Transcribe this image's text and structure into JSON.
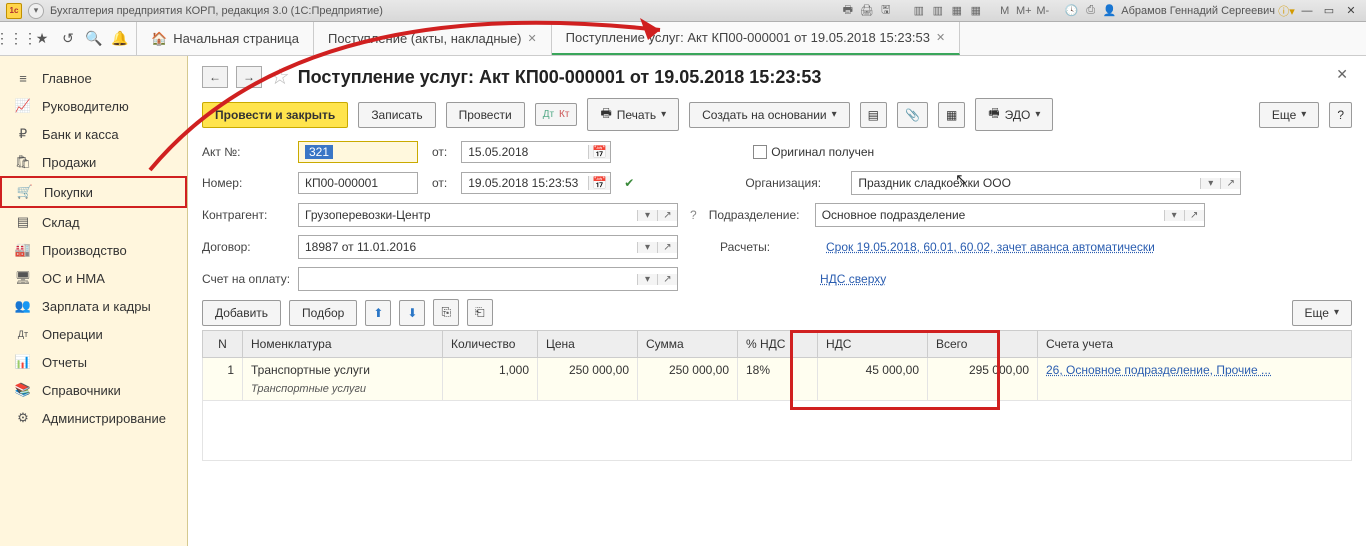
{
  "titlebar": {
    "title": "Бухгалтерия предприятия КОРП, редакция 3.0  (1С:Предприятие)",
    "user": "Абрамов Геннадий Сергеевич",
    "m_labels": [
      "M",
      "M+",
      "M-"
    ]
  },
  "tabs": {
    "home": "Начальная страница",
    "tab1": "Поступление (акты, накладные)",
    "tab2": "Поступление услуг: Акт КП00-000001 от 19.05.2018 15:23:53"
  },
  "sidebar": {
    "items": [
      {
        "label": "Главное",
        "icon": "≡"
      },
      {
        "label": "Руководителю",
        "icon": "📈"
      },
      {
        "label": "Банк и касса",
        "icon": "₽"
      },
      {
        "label": "Продажи",
        "icon": "🛍"
      },
      {
        "label": "Покупки",
        "icon": "🛒",
        "highlight": true
      },
      {
        "label": "Склад",
        "icon": "▤"
      },
      {
        "label": "Производство",
        "icon": "🏭"
      },
      {
        "label": "ОС и НМА",
        "icon": "🖥"
      },
      {
        "label": "Зарплата и кадры",
        "icon": "👥"
      },
      {
        "label": "Операции",
        "icon": "Дт"
      },
      {
        "label": "Отчеты",
        "icon": "📊"
      },
      {
        "label": "Справочники",
        "icon": "📚"
      },
      {
        "label": "Администрирование",
        "icon": "⚙"
      }
    ]
  },
  "page": {
    "title": "Поступление услуг: Акт КП00-000001 от 19.05.2018 15:23:53"
  },
  "toolbar": {
    "run_close": "Провести и закрыть",
    "record": "Записать",
    "run": "Провести",
    "print": "Печать",
    "base_create": "Создать на основании",
    "edo": "ЭДО",
    "more": "Еще"
  },
  "form": {
    "act_no_lbl": "Акт №:",
    "act_no_val": "321",
    "act_from": "от:",
    "act_date": "15.05.2018",
    "orig_recv": "Оригинал получен",
    "number_lbl": "Номер:",
    "number_val": "КП00-000001",
    "number_date": "19.05.2018 15:23:53",
    "org_lbl": "Организация:",
    "org_val": "Праздник сладкоежки ООО",
    "cagent_lbl": "Контрагент:",
    "cagent_val": "Грузоперевозки-Центр",
    "dept_lbl": "Подразделение:",
    "dept_val": "Основное подразделение",
    "contract_lbl": "Договор:",
    "contract_val": "18987 от 11.01.2016",
    "calc_lbl": "Расчеты:",
    "calc_link": "Срок 19.05.2018, 60.01, 60.02, зачет аванса автоматически",
    "invoice_lbl": "Счет на оплату:",
    "vat_link": "НДС сверху"
  },
  "tabletoolbar": {
    "add": "Добавить",
    "select": "Подбор",
    "more": "Еще"
  },
  "grid": {
    "headers": {
      "n": "N",
      "item": "Номенклатура",
      "qty": "Количество",
      "price": "Цена",
      "sum": "Сумма",
      "vatp": "% НДС",
      "vat": "НДС",
      "total": "Всего",
      "accounts": "Счета учета"
    },
    "row": {
      "n": "1",
      "item": "Транспортные услуги",
      "item2": "Транспортные услуги",
      "qty": "1,000",
      "price": "250 000,00",
      "sum": "250 000,00",
      "vatp": "18%",
      "vat": "45 000,00",
      "total": "295 000,00",
      "accounts": "26, Основное подразделение, Прочие ..."
    }
  }
}
